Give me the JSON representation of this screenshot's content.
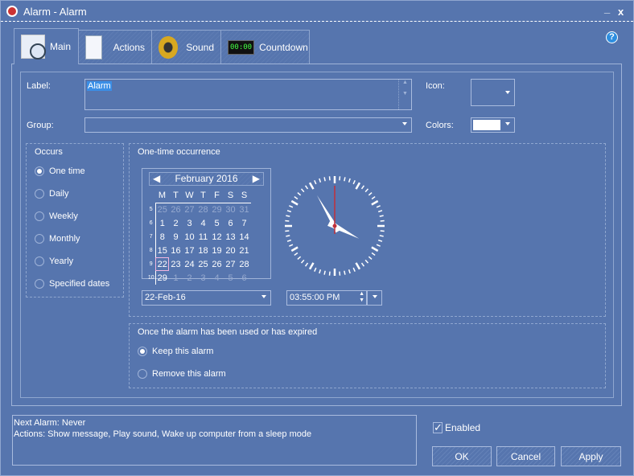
{
  "window": {
    "title": "Alarm - Alarm",
    "minimize": "_",
    "close": "x",
    "help": "?"
  },
  "tabs": [
    {
      "label": "Main",
      "icon": "calendar-clock-icon"
    },
    {
      "label": "Actions",
      "icon": "checklist-icon"
    },
    {
      "label": "Sound",
      "icon": "speaker-icon"
    },
    {
      "label": "Countdown",
      "icon": "digital-timer-icon",
      "display": "00:00"
    }
  ],
  "form": {
    "label_caption": "Label:",
    "label_value": "Alarm",
    "icon_caption": "Icon:",
    "group_caption": "Group:",
    "group_value": "",
    "colors_caption": "Colors:",
    "color_value": "#ffffff"
  },
  "occurs": {
    "title": "Occurs",
    "options": [
      "One time",
      "Daily",
      "Weekly",
      "Monthly",
      "Yearly",
      "Specified dates"
    ],
    "selected": 0
  },
  "onetime": {
    "title": "One-time occurrence",
    "month": "February 2016",
    "weekdays": [
      "M",
      "T",
      "W",
      "T",
      "F",
      "S",
      "S"
    ],
    "weeks": [
      {
        "n": "5",
        "days": [
          "25",
          "26",
          "27",
          "28",
          "29",
          "30",
          "31"
        ]
      },
      {
        "n": "6",
        "days": [
          "1",
          "2",
          "3",
          "4",
          "5",
          "6",
          "7"
        ]
      },
      {
        "n": "7",
        "days": [
          "8",
          "9",
          "10",
          "11",
          "12",
          "13",
          "14"
        ]
      },
      {
        "n": "8",
        "days": [
          "15",
          "16",
          "17",
          "18",
          "19",
          "20",
          "21"
        ]
      },
      {
        "n": "9",
        "days": [
          "22",
          "23",
          "24",
          "25",
          "26",
          "27",
          "28"
        ]
      },
      {
        "n": "10",
        "days": [
          "29",
          "1",
          "2",
          "3",
          "4",
          "5",
          "6"
        ]
      }
    ],
    "selected_day": "22",
    "date_value": "22-Feb-16",
    "time_value": "03:55:00 PM",
    "clock": {
      "hour": 3,
      "minute": 55,
      "second": 0
    }
  },
  "expiry": {
    "title": "Once the alarm has been used or has expired",
    "options": [
      "Keep this alarm",
      "Remove this alarm"
    ],
    "selected": 0
  },
  "info": {
    "line1": "Next Alarm: Never",
    "line2": "Actions: Show message, Play sound, Wake up computer from a sleep mode"
  },
  "enabled": {
    "label": "Enabled",
    "checked": true
  },
  "buttons": {
    "ok": "OK",
    "cancel": "Cancel",
    "apply": "Apply"
  }
}
